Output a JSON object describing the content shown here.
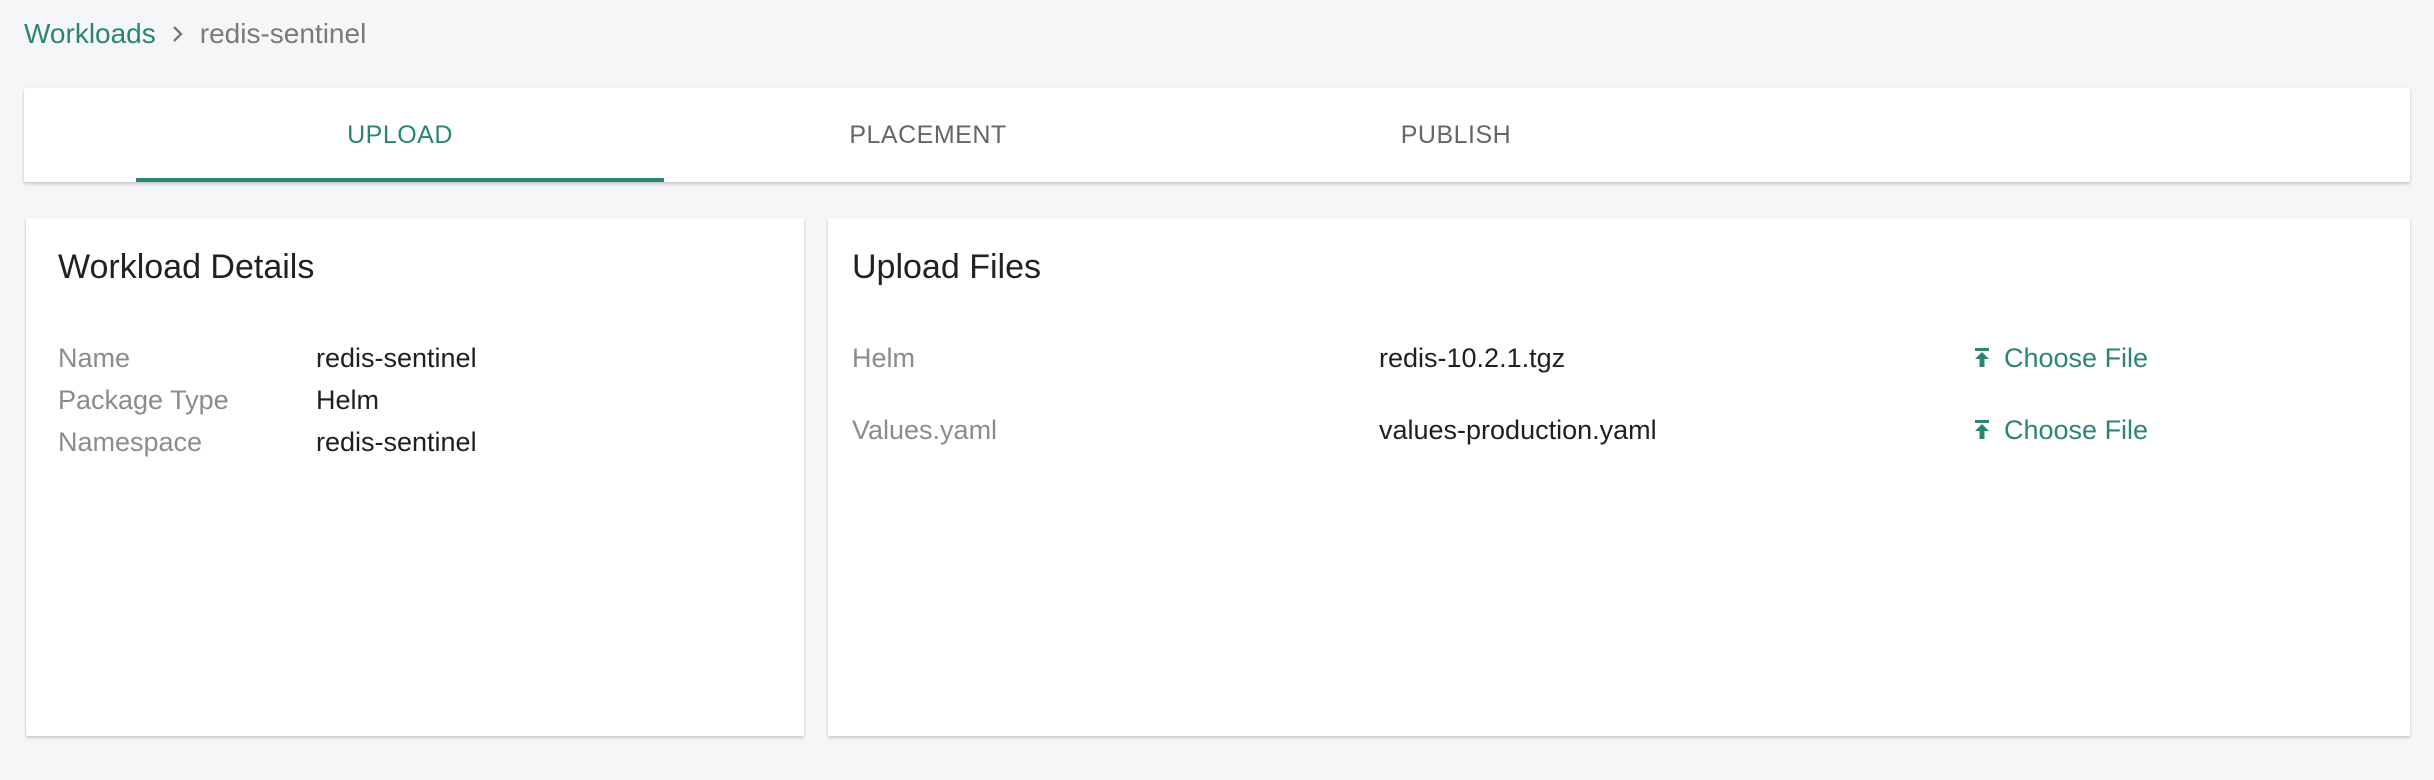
{
  "breadcrumb": {
    "parent": "Workloads",
    "current": "redis-sentinel"
  },
  "tabs": [
    {
      "label": "UPLOAD",
      "active": true
    },
    {
      "label": "PLACEMENT",
      "active": false
    },
    {
      "label": "PUBLISH",
      "active": false
    }
  ],
  "details": {
    "title": "Workload Details",
    "rows": [
      {
        "label": "Name",
        "value": "redis-sentinel"
      },
      {
        "label": "Package Type",
        "value": "Helm"
      },
      {
        "label": "Namespace",
        "value": "redis-sentinel"
      }
    ]
  },
  "upload": {
    "title": "Upload Files",
    "rows": [
      {
        "label": "Helm",
        "filename": "redis-10.2.1.tgz",
        "button": "Choose File",
        "icon": "upload-icon"
      },
      {
        "label": "Values.yaml",
        "filename": "values-production.yaml",
        "button": "Choose File",
        "icon": "upload-icon"
      }
    ]
  },
  "colors": {
    "accent": "#2a8574",
    "background": "#f5f6f8",
    "muted_text": "#8c8c8c"
  }
}
